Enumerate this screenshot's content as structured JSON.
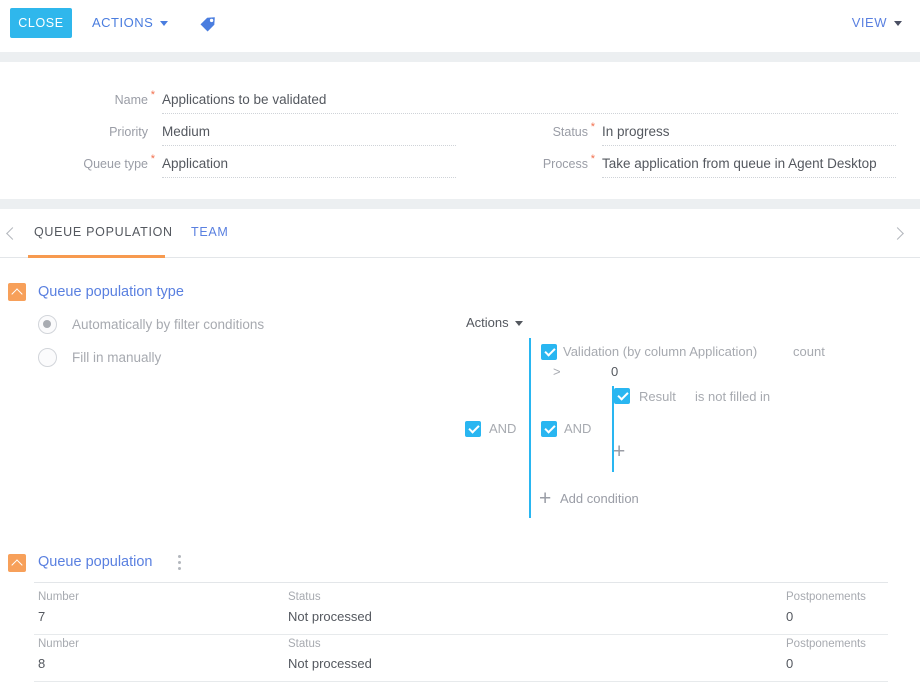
{
  "toolbar": {
    "close_label": "CLOSE",
    "actions_label": "ACTIONS",
    "tag_icon": "tag-icon",
    "view_label": "VIEW"
  },
  "header_form": {
    "left": [
      {
        "label": "Name",
        "required": true,
        "value": "Applications to be validated"
      },
      {
        "label": "Priority",
        "required": false,
        "value": "Medium"
      },
      {
        "label": "Queue type",
        "required": true,
        "value": "Application"
      }
    ],
    "right": [
      {
        "label": "Status",
        "required": true,
        "value": "In progress"
      },
      {
        "label": "Process",
        "required": true,
        "value": "Take application from queue in Agent Desktop"
      }
    ]
  },
  "tabs": {
    "prev_icon": "chevron-left-icon",
    "next_icon": "chevron-right-icon",
    "items": [
      {
        "label": "QUEUE POPULATION",
        "active": true
      },
      {
        "label": "TEAM",
        "active": false
      }
    ]
  },
  "population_type": {
    "title": "Queue population type",
    "collapse_icon": "chevron-up-icon",
    "options": [
      {
        "label": "Automatically by filter conditions",
        "selected": true
      },
      {
        "label": "Fill in manually",
        "selected": false
      }
    ]
  },
  "filter": {
    "actions_label": "Actions",
    "group_outer_and": "AND",
    "group_inner_and": "AND",
    "add_condition_label": "Add condition",
    "add_icon": "plus-icon",
    "conditions": {
      "column": "Validation (by column Application)",
      "aggregate": "count",
      "operator": ">",
      "value": "0",
      "sub_column": "Result",
      "sub_operator": "is not filled in"
    }
  },
  "queue_population": {
    "title": "Queue population",
    "collapse_icon": "chevron-up-icon",
    "menu_icon": "kebab-menu-icon",
    "columns": [
      "Number",
      "Status",
      "Postponements"
    ],
    "rows": [
      {
        "number": "7",
        "status": "Not processed",
        "postponements": "0"
      },
      {
        "number": "8",
        "status": "Not processed",
        "postponements": "0"
      }
    ]
  },
  "colors": {
    "primary_button": "#2fb7ec",
    "link": "#5a80e0",
    "accent_orange": "#f79a4f",
    "checkbox": "#29b6f1",
    "required_star": "#f2714f"
  }
}
